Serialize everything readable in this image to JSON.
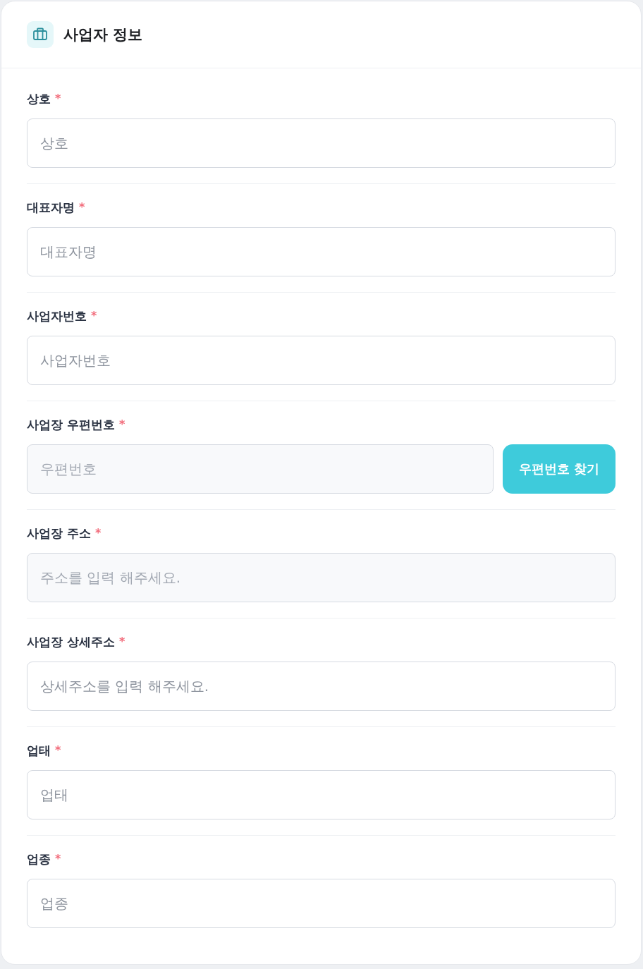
{
  "card": {
    "title": "사업자 정보"
  },
  "fields": [
    {
      "label": "상호",
      "mark": "*",
      "placeholder": "상호",
      "readonly": false
    },
    {
      "label": "대표자명",
      "mark": "*",
      "placeholder": "대표자명",
      "readonly": false
    },
    {
      "label": "사업자번호",
      "mark": "*",
      "placeholder": "사업자번호",
      "readonly": false
    },
    {
      "label": "사업장 우편번호",
      "mark": "*",
      "placeholder": "우편번호",
      "readonly": true,
      "button": "우편번호 찾기"
    },
    {
      "label": "사업장 주소",
      "mark": "*",
      "placeholder": "주소를 입력 해주세요.",
      "readonly": true
    },
    {
      "label": "사업장 상세주소",
      "mark": "*",
      "placeholder": "상세주소를 입력 해주세요.",
      "readonly": false
    },
    {
      "label": "업태",
      "mark": "*",
      "placeholder": "업태",
      "readonly": false
    },
    {
      "label": "업종",
      "mark": "*",
      "placeholder": "업종",
      "readonly": false
    }
  ]
}
